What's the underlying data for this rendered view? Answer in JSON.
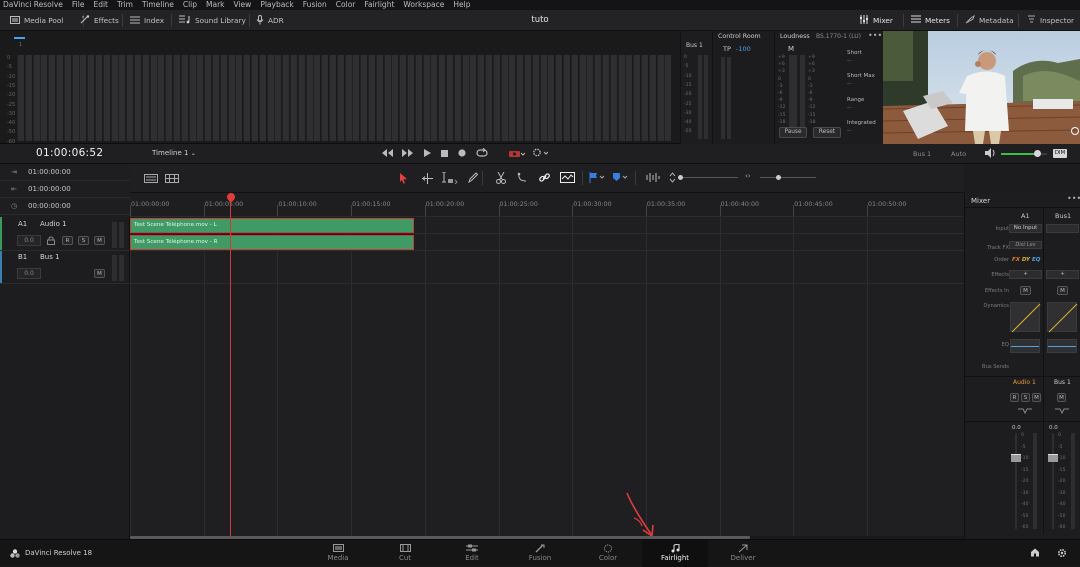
{
  "menubar": [
    "DaVinci Resolve",
    "File",
    "Edit",
    "Trim",
    "Timeline",
    "Clip",
    "Mark",
    "View",
    "Playback",
    "Fusion",
    "Color",
    "Fairlight",
    "Workspace",
    "Help"
  ],
  "toolbar": {
    "left": [
      {
        "label": "Media Pool",
        "icon": "media-pool-icon"
      },
      {
        "label": "Effects",
        "icon": "effects-icon"
      },
      {
        "label": "Index",
        "icon": "index-icon"
      },
      {
        "label": "Sound Library",
        "icon": "sound-library-icon"
      },
      {
        "label": "ADR",
        "icon": "adr-icon"
      }
    ],
    "right": [
      {
        "label": "Mixer",
        "icon": "mixer-icon"
      },
      {
        "label": "Meters",
        "icon": "meters-icon"
      },
      {
        "label": "Metadata",
        "icon": "metadata-icon"
      },
      {
        "label": "Inspector",
        "icon": "inspector-icon"
      }
    ],
    "project_title": "tuto"
  },
  "meters": {
    "scale": [
      "0",
      "-5",
      "-10",
      "-15",
      "-20",
      "-25",
      "-30",
      "-40",
      "-50",
      "-60"
    ],
    "bus_label": "Bus 1",
    "bus_scale": [
      "0",
      "-5",
      "-10",
      "-15",
      "-20",
      "-25",
      "-30",
      "-40",
      "-50"
    ],
    "control_room": {
      "title": "Control Room",
      "tp_label": "TP",
      "tp_value": "-100"
    },
    "loudness": {
      "title": "Loudness",
      "standard": "BS.1770-1 (LU)",
      "m_label": "M",
      "scale_left": [
        "+9",
        "+6",
        "+3",
        "0",
        "-3",
        "-6",
        "-9",
        "-12",
        "-15",
        "-18"
      ],
      "scale_right": [
        "+9",
        "+6",
        "+3",
        "0",
        "-3",
        "-6",
        "-9",
        "-12",
        "-15",
        "-18"
      ],
      "pause": "Pause",
      "reset": "Reset"
    },
    "stats": [
      {
        "label": "Short",
        "value": "--"
      },
      {
        "label": "Short Max",
        "value": "--"
      },
      {
        "label": "Range",
        "value": "--"
      },
      {
        "label": "Integrated",
        "value": "--"
      }
    ]
  },
  "transport": {
    "timecode": "01:00:06:52",
    "timeline_name": "Timeline 1",
    "bus_label": "Bus 1",
    "auto_label": "Auto",
    "dim_label": "DIM",
    "volume_fraction": 0.78
  },
  "tc_rows": [
    "01:00:00:00",
    "01:00:00:00",
    "00:00:00:00"
  ],
  "tracks": [
    {
      "id": "A1",
      "name": "Audio 1",
      "level": "0.0",
      "buttons": [
        "R",
        "S",
        "M"
      ],
      "color": "#3a9a5c"
    },
    {
      "id": "B1",
      "name": "Bus 1",
      "level": "0.0",
      "buttons": [
        "M"
      ],
      "color": "#3b7fb0"
    }
  ],
  "ruler": [
    "01:00:00:00",
    "01:00:05:00",
    "01:00:10:00",
    "01:00:15:00",
    "01:00:20:00",
    "01:00:25:00",
    "01:00:30:00",
    "01:00:35:00",
    "01:00:40:00",
    "01:00:45:00",
    "01:00:50:00"
  ],
  "clips": [
    {
      "label": "Test Scene Téléphone.mov - L"
    },
    {
      "label": "Test Scene Téléphone.mov - R"
    }
  ],
  "mixer": {
    "title": "Mixer",
    "col_a": "A1",
    "col_b": "Bus1",
    "input_label": "Input",
    "input_value": "No Input",
    "trackfx_label": "Track FX",
    "trackfx_value": "Dist Lev",
    "order_label": "Order",
    "order_value": "FX DY EQ",
    "effects_label": "Effects",
    "effects_in_label": "Effects In",
    "dynamics_label": "Dynamics",
    "eq_label": "EQ",
    "bus_sends_label": "Bus Sends",
    "strip_a": "Audio 1",
    "strip_b": "Bus 1",
    "fader_a": "0.0",
    "fader_b": "0.0",
    "fader_scale": [
      "0",
      "-5",
      "-10",
      "-15",
      "-20",
      "-30",
      "-40",
      "-50",
      "-60"
    ],
    "plus": "+",
    "m": "M",
    "r": "R",
    "s": "S"
  },
  "footer": {
    "app": "DaVinci Resolve 18",
    "pages": [
      {
        "label": "Media",
        "icon": "media-page-icon"
      },
      {
        "label": "Cut",
        "icon": "cut-page-icon"
      },
      {
        "label": "Edit",
        "icon": "edit-page-icon"
      },
      {
        "label": "Fusion",
        "icon": "fusion-page-icon"
      },
      {
        "label": "Color",
        "icon": "color-page-icon"
      },
      {
        "label": "Fairlight",
        "icon": "fairlight-page-icon",
        "selected": true
      },
      {
        "label": "Deliver",
        "icon": "deliver-page-icon"
      }
    ]
  },
  "colors": {
    "playhead": "#d23a3a",
    "clip": "#3f9a66",
    "annotation": "#e23b3b",
    "accent": "#4aa3e8"
  }
}
